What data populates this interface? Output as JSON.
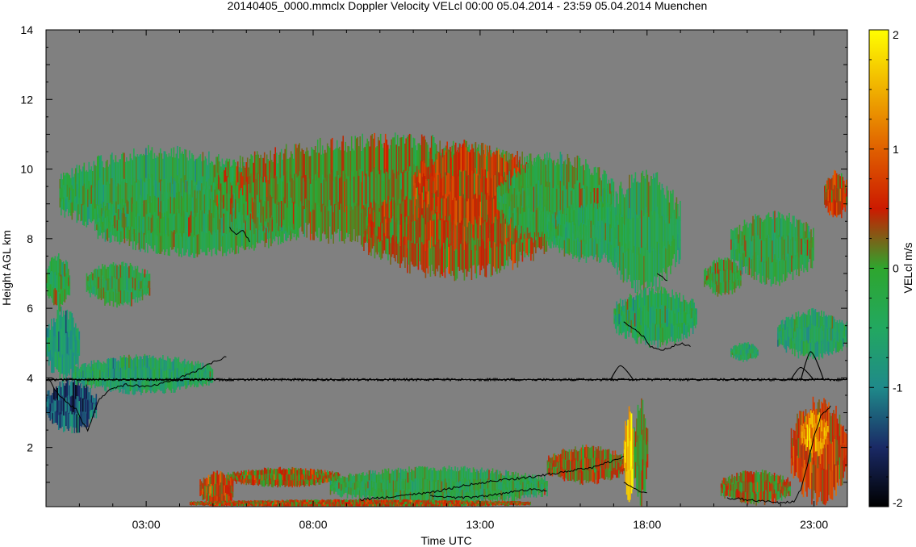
{
  "chart_data": {
    "type": "heatmap",
    "title": "20140405_0000.mmclx Doppler Velocity VELcl   00:00 05.04.2014 - 23:59 05.04.2014 Muenchen",
    "xlabel": "Time UTC",
    "ylabel": "Height AGL km",
    "colorbar_label": "VELcl m/s",
    "xlim": [
      0.0,
      24.0
    ],
    "ylim": [
      0.3,
      14.0
    ],
    "xticks": [
      {
        "value": 3,
        "label": "03:00"
      },
      {
        "value": 8,
        "label": "08:00"
      },
      {
        "value": 13,
        "label": "13:00"
      },
      {
        "value": 18,
        "label": "18:00"
      },
      {
        "value": 23,
        "label": "23:00"
      }
    ],
    "yticks": [
      {
        "value": 2,
        "label": "2"
      },
      {
        "value": 4,
        "label": "4"
      },
      {
        "value": 6,
        "label": "6"
      },
      {
        "value": 8,
        "label": "8"
      },
      {
        "value": 10,
        "label": "10"
      },
      {
        "value": 12,
        "label": "12"
      },
      {
        "value": 14,
        "label": "14"
      }
    ],
    "colorbar": {
      "range": [
        -2,
        2
      ],
      "ticks": [
        {
          "value": 2,
          "label": "2"
        },
        {
          "value": 1,
          "label": "1"
        },
        {
          "value": 0,
          "label": "0"
        },
        {
          "value": -1,
          "label": "-1"
        },
        {
          "value": -2,
          "label": "-2"
        }
      ],
      "stops": [
        {
          "value": -2.0,
          "color": "#000000"
        },
        {
          "value": -1.5,
          "color": "#1a2a66"
        },
        {
          "value": -1.0,
          "color": "#1f8a8a"
        },
        {
          "value": -0.5,
          "color": "#22a860"
        },
        {
          "value": 0.0,
          "color": "#2ea62e"
        },
        {
          "value": 0.5,
          "color": "#cc1a00"
        },
        {
          "value": 1.0,
          "color": "#e06000"
        },
        {
          "value": 1.5,
          "color": "#f0b000"
        },
        {
          "value": 2.0,
          "color": "#ffff00"
        }
      ]
    },
    "background_color": "#808080",
    "reference_line_height": 3.95,
    "regions": [
      {
        "t0": 0.4,
        "t1": 6.5,
        "h0": 8.1,
        "h1": 10.5,
        "v": -0.3
      },
      {
        "t0": 1.5,
        "t1": 7.5,
        "h0": 7.6,
        "h1": 9.3,
        "v": -0.2
      },
      {
        "t0": 5.0,
        "t1": 15.5,
        "h0": 8.0,
        "h1": 10.8,
        "v": 0.1
      },
      {
        "t0": 9.5,
        "t1": 15.0,
        "h0": 7.0,
        "h1": 9.5,
        "v": 0.3
      },
      {
        "t0": 11.0,
        "t1": 14.5,
        "h0": 8.5,
        "h1": 10.6,
        "v": 0.55
      },
      {
        "t0": 13.5,
        "t1": 17.0,
        "h0": 8.0,
        "h1": 10.3,
        "v": -0.15
      },
      {
        "t0": 15.0,
        "t1": 17.5,
        "h0": 7.4,
        "h1": 9.0,
        "v": -0.35
      },
      {
        "t0": 16.8,
        "t1": 19.0,
        "h0": 6.6,
        "h1": 9.8,
        "v": -0.3
      },
      {
        "t0": 17.0,
        "t1": 19.5,
        "h0": 5.0,
        "h1": 6.5,
        "v": -0.4
      },
      {
        "t0": 19.7,
        "t1": 20.8,
        "h0": 6.4,
        "h1": 7.4,
        "v": -0.1
      },
      {
        "t0": 20.5,
        "t1": 23.0,
        "h0": 6.8,
        "h1": 8.7,
        "v": -0.2
      },
      {
        "t0": 20.5,
        "t1": 21.3,
        "h0": 4.5,
        "h1": 5.0,
        "v": -0.45
      },
      {
        "t0": 21.9,
        "t1": 24.0,
        "h0": 4.6,
        "h1": 5.9,
        "v": -0.5
      },
      {
        "t0": 23.3,
        "t1": 24.0,
        "h0": 8.6,
        "h1": 9.9,
        "v": 0.5
      },
      {
        "t0": 0.0,
        "t1": 0.7,
        "h0": 6.0,
        "h1": 7.5,
        "v": -0.2
      },
      {
        "t0": 1.2,
        "t1": 3.1,
        "h0": 6.1,
        "h1": 7.3,
        "v": -0.2
      },
      {
        "t0": 0.0,
        "t1": 1.0,
        "h0": 4.0,
        "h1": 5.9,
        "v": -0.7
      },
      {
        "t0": 0.0,
        "t1": 1.5,
        "h0": 2.5,
        "h1": 3.9,
        "v": -1.3
      },
      {
        "t0": 0.8,
        "t1": 5.0,
        "h0": 3.6,
        "h1": 4.6,
        "v": -0.5
      },
      {
        "t0": 5.4,
        "t1": 8.8,
        "h0": 0.9,
        "h1": 1.4,
        "v": 0.3
      },
      {
        "t0": 4.6,
        "t1": 5.6,
        "h0": 0.3,
        "h1": 1.3,
        "v": 0.55
      },
      {
        "t0": 8.5,
        "t1": 15.0,
        "h0": 0.4,
        "h1": 1.4,
        "v": -0.25
      },
      {
        "t0": 15.0,
        "t1": 17.4,
        "h0": 1.0,
        "h1": 2.0,
        "v": 0.3
      },
      {
        "t0": 17.3,
        "t1": 17.6,
        "h0": 0.6,
        "h1": 3.0,
        "v": 1.6
      },
      {
        "t0": 17.6,
        "t1": 18.0,
        "h0": 0.5,
        "h1": 3.2,
        "v": 0.1
      },
      {
        "t0": 20.2,
        "t1": 22.3,
        "h0": 0.4,
        "h1": 1.3,
        "v": 0.2
      },
      {
        "t0": 22.3,
        "t1": 24.0,
        "h0": 0.5,
        "h1": 3.3,
        "v": 0.6
      },
      {
        "t0": 22.6,
        "t1": 23.4,
        "h0": 1.8,
        "h1": 3.0,
        "v": 1.3
      },
      {
        "t0": 4.3,
        "t1": 14.5,
        "h0": 0.3,
        "h1": 0.5,
        "v": 0.4
      }
    ],
    "traces": [
      {
        "name_key": "lower-boundary",
        "points": [
          [
            0.1,
            3.95
          ],
          [
            0.3,
            3.6
          ],
          [
            0.6,
            3.3
          ],
          [
            0.9,
            3.1
          ],
          [
            1.1,
            2.7
          ],
          [
            1.25,
            2.5
          ],
          [
            1.4,
            2.9
          ],
          [
            1.6,
            3.4
          ],
          [
            2.0,
            3.7
          ],
          [
            2.4,
            3.8
          ],
          [
            3.0,
            3.75
          ],
          [
            3.5,
            3.85
          ],
          [
            4.0,
            3.95
          ]
        ]
      },
      {
        "name_key": "cloud-top-4km",
        "points": [
          [
            4.0,
            4.0
          ],
          [
            4.5,
            4.2
          ],
          [
            5.0,
            4.45
          ],
          [
            5.4,
            4.6
          ]
        ]
      },
      {
        "name_key": "cloud-base-8km",
        "points": [
          [
            5.5,
            8.3
          ],
          [
            5.7,
            8.1
          ],
          [
            5.9,
            8.25
          ],
          [
            6.1,
            7.9
          ]
        ]
      },
      {
        "name_key": "cloud-base-17h",
        "points": [
          [
            17.3,
            5.6
          ],
          [
            17.6,
            5.4
          ],
          [
            17.9,
            5.2
          ],
          [
            18.1,
            4.9
          ],
          [
            18.5,
            4.8
          ],
          [
            19.0,
            5.0
          ],
          [
            19.3,
            4.9
          ]
        ]
      },
      {
        "name_key": "cloud-base-19h",
        "points": [
          [
            18.3,
            7.0
          ],
          [
            18.6,
            6.8
          ]
        ]
      },
      {
        "name_key": "boundary-layer-morning",
        "points": [
          [
            9.4,
            0.5
          ],
          [
            10.5,
            0.6
          ],
          [
            11.5,
            0.7
          ],
          [
            12.5,
            0.9
          ],
          [
            13.5,
            1.05
          ],
          [
            14.5,
            1.15
          ],
          [
            15.5,
            1.3
          ],
          [
            16.5,
            1.45
          ],
          [
            17.3,
            1.75
          ]
        ]
      },
      {
        "name_key": "boundary-layer-dip",
        "points": [
          [
            11.5,
            0.6
          ],
          [
            12.5,
            0.55
          ],
          [
            13.5,
            0.65
          ],
          [
            14.5,
            0.8
          ],
          [
            15.0,
            0.75
          ]
        ]
      },
      {
        "name_key": "boundary-layer-18h",
        "points": [
          [
            17.3,
            1.0
          ],
          [
            17.6,
            0.8
          ],
          [
            18.0,
            0.7
          ]
        ]
      },
      {
        "name_key": "boundary-layer-evening",
        "points": [
          [
            20.4,
            0.55
          ],
          [
            21.0,
            0.5
          ],
          [
            21.6,
            0.45
          ],
          [
            22.0,
            0.4
          ],
          [
            22.4,
            0.45
          ],
          [
            22.6,
            0.8
          ],
          [
            22.8,
            1.5
          ],
          [
            23.0,
            2.3
          ],
          [
            23.2,
            2.9
          ],
          [
            23.5,
            3.2
          ]
        ]
      }
    ],
    "bumps": [
      {
        "t": 17.2,
        "h": 4.35
      },
      {
        "t": 22.9,
        "h": 4.75
      },
      {
        "t": 22.6,
        "h": 4.3
      }
    ]
  }
}
